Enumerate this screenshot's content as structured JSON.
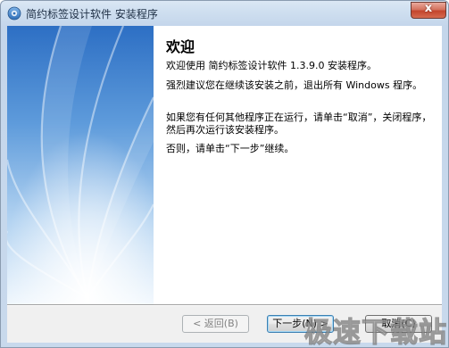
{
  "window": {
    "title": "简约标签设计软件 安装程序",
    "close_label": "x"
  },
  "page": {
    "heading": "欢迎",
    "paragraphs": [
      "欢迎使用 简约标签设计软件 1.3.9.0 安装程序。",
      "强烈建议您在继续该安装之前，退出所有 Windows 程序。",
      "如果您有任何其他程序正在运行，请单击“取消”，关闭程序，然后再次运行该安装程序。",
      "否则，请单击“下一步”继续。"
    ]
  },
  "buttons": {
    "back": "< 返回(B)",
    "next": "下一步(N) >",
    "cancel": "取消(C)"
  },
  "watermark": {
    "text": "极速下载站"
  },
  "colors": {
    "title_bar": "#cfdff0",
    "close_button": "#c4452d",
    "banner_gradient_top": "#3b7fcf",
    "banner_gradient_bottom": "#e4f0fb"
  }
}
